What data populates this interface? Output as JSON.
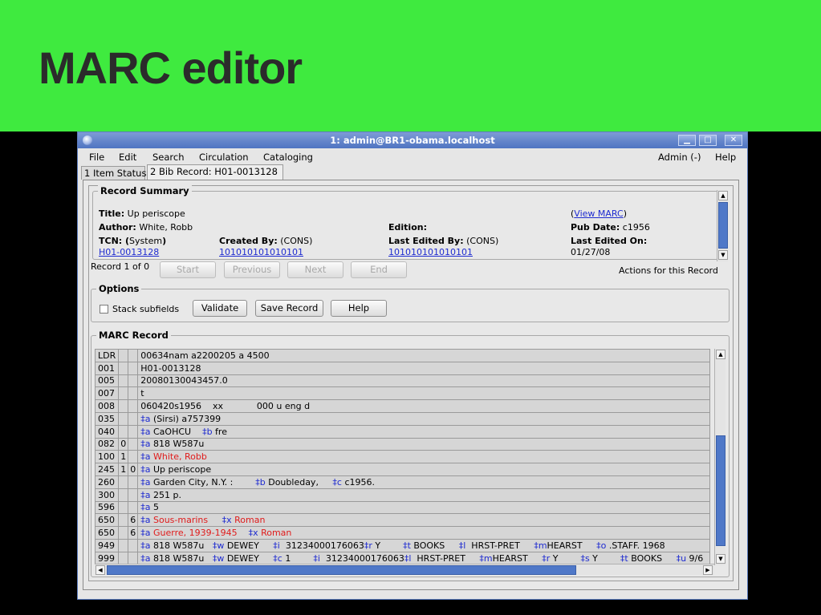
{
  "banner": {
    "title": "MARC editor"
  },
  "window": {
    "title": "1: admin@BR1-obama.localhost",
    "minimize": "▁",
    "maximize": "□",
    "close": "✕"
  },
  "menu": {
    "file": "File",
    "edit": "Edit",
    "search": "Search",
    "circulation": "Circulation",
    "cataloging": "Cataloging",
    "admin": "Admin (-)",
    "help": "Help"
  },
  "tabs": [
    {
      "label": "1 Item Status"
    },
    {
      "label": "2 Bib Record: H01-0013128"
    }
  ],
  "summary": {
    "legend": "Record Summary",
    "title_label": "Title:",
    "title_value": "Up periscope",
    "author_label": "Author:",
    "author_value": "White, Robb",
    "edition_label": "Edition:",
    "tcn_label": "TCN: (",
    "tcn_source": "System",
    "tcn_close": ")",
    "tcn_value": "H01-0013128",
    "created_label": "Created By:",
    "created_value": "(CONS)",
    "created_link": "101010101010101",
    "edited_label": "Last Edited By:",
    "edited_value": "(CONS)",
    "edited_link": "101010101010101",
    "view_marc_open": "(",
    "view_marc": "View MARC",
    "view_marc_close": ")",
    "pubdate_label": "Pub Date:",
    "pubdate_value": "c1956",
    "edited_on_label": "Last Edited On:",
    "edited_on_value": "01/27/08"
  },
  "nav": {
    "record_count": "Record 1 of 0",
    "start": "Start",
    "previous": "Previous",
    "next": "Next",
    "end": "End",
    "actions": "Actions for this Record"
  },
  "options": {
    "legend": "Options",
    "stack_label": "Stack subfields",
    "validate": "Validate",
    "save": "Save Record",
    "help": "Help"
  },
  "marc": {
    "legend": "MARC Record",
    "rows": [
      {
        "tag": "LDR",
        "i1": "",
        "i2": "",
        "segs": [
          {
            "t": "00634nam a2200205 a 4500"
          }
        ]
      },
      {
        "tag": "001",
        "i1": "",
        "i2": "",
        "segs": [
          {
            "t": "H01-0013128"
          }
        ]
      },
      {
        "tag": "005",
        "i1": "",
        "i2": "",
        "segs": [
          {
            "t": "20080130043457.0"
          }
        ]
      },
      {
        "tag": "007",
        "i1": "",
        "i2": "",
        "segs": [
          {
            "t": "t"
          }
        ]
      },
      {
        "tag": "008",
        "i1": "",
        "i2": "",
        "segs": [
          {
            "t": "060420s1956    xx            000 u eng d"
          }
        ]
      },
      {
        "tag": "035",
        "i1": "",
        "i2": "",
        "segs": [
          {
            "c": "sf",
            "t": "‡a"
          },
          {
            "t": " (Sirsi) a757399"
          }
        ]
      },
      {
        "tag": "040",
        "i1": "",
        "i2": "",
        "segs": [
          {
            "c": "sf",
            "t": "‡a"
          },
          {
            "t": " CaOHCU    "
          },
          {
            "c": "sf",
            "t": "‡b"
          },
          {
            "t": " fre"
          }
        ]
      },
      {
        "tag": "082",
        "i1": "0",
        "i2": "",
        "segs": [
          {
            "c": "sf",
            "t": "‡a"
          },
          {
            "t": " 818 W587u"
          }
        ]
      },
      {
        "tag": "100",
        "i1": "1",
        "i2": "",
        "segs": [
          {
            "c": "sf",
            "t": "‡a"
          },
          {
            "c": "red",
            "t": " White, Robb"
          }
        ]
      },
      {
        "tag": "245",
        "i1": "1",
        "i2": "0",
        "segs": [
          {
            "c": "sf",
            "t": "‡a"
          },
          {
            "t": " Up periscope"
          }
        ]
      },
      {
        "tag": "260",
        "i1": "",
        "i2": "",
        "segs": [
          {
            "c": "sf",
            "t": "‡a"
          },
          {
            "t": " Garden City, N.Y. :        "
          },
          {
            "c": "sf",
            "t": "‡b"
          },
          {
            "t": " Doubleday,     "
          },
          {
            "c": "sf",
            "t": "‡c"
          },
          {
            "t": " c1956."
          }
        ]
      },
      {
        "tag": "300",
        "i1": "",
        "i2": "",
        "segs": [
          {
            "c": "sf",
            "t": "‡a"
          },
          {
            "t": " 251 p."
          }
        ]
      },
      {
        "tag": "596",
        "i1": "",
        "i2": "",
        "segs": [
          {
            "c": "sf",
            "t": "‡a"
          },
          {
            "t": " 5"
          }
        ]
      },
      {
        "tag": "650",
        "i1": "",
        "i2": "6",
        "segs": [
          {
            "c": "sf",
            "t": "‡a"
          },
          {
            "c": "red",
            "t": " Sous-marins     "
          },
          {
            "c": "sf",
            "t": "‡x"
          },
          {
            "c": "red",
            "t": " Roman"
          }
        ]
      },
      {
        "tag": "650",
        "i1": "",
        "i2": "6",
        "segs": [
          {
            "c": "sf",
            "t": "‡a"
          },
          {
            "c": "red",
            "t": " Guerre, 1939-1945    "
          },
          {
            "c": "sf",
            "t": "‡x"
          },
          {
            "c": "red",
            "t": " Roman"
          }
        ]
      },
      {
        "tag": "949",
        "i1": "",
        "i2": "",
        "segs": [
          {
            "c": "sf",
            "t": "‡a"
          },
          {
            "t": " 818 W587u   "
          },
          {
            "c": "sf",
            "t": "‡w"
          },
          {
            "t": " DEWEY     "
          },
          {
            "c": "sf",
            "t": "‡i"
          },
          {
            "t": "  31234000176063"
          },
          {
            "c": "sf",
            "t": "‡r"
          },
          {
            "t": " Y        "
          },
          {
            "c": "sf",
            "t": "‡t"
          },
          {
            "t": " BOOKS     "
          },
          {
            "c": "sf",
            "t": "‡l"
          },
          {
            "t": "  HRST-PRET     "
          },
          {
            "c": "sf",
            "t": "‡m"
          },
          {
            "t": "HEARST     "
          },
          {
            "c": "sf",
            "t": "‡o"
          },
          {
            "t": " .STAFF. 1968"
          }
        ]
      },
      {
        "tag": "999",
        "i1": "",
        "i2": "",
        "segs": [
          {
            "c": "sf",
            "t": "‡a"
          },
          {
            "t": " 818 W587u   "
          },
          {
            "c": "sf",
            "t": "‡w"
          },
          {
            "t": " DEWEY     "
          },
          {
            "c": "sf",
            "t": "‡c"
          },
          {
            "t": " 1        "
          },
          {
            "c": "sf",
            "t": "‡i"
          },
          {
            "t": "  31234000176063"
          },
          {
            "c": "sf",
            "t": "‡l"
          },
          {
            "t": "  HRST-PRET     "
          },
          {
            "c": "sf",
            "t": "‡m"
          },
          {
            "t": "HEARST     "
          },
          {
            "c": "sf",
            "t": "‡r"
          },
          {
            "t": " Y        "
          },
          {
            "c": "sf",
            "t": "‡s"
          },
          {
            "t": " Y        "
          },
          {
            "c": "sf",
            "t": "‡t"
          },
          {
            "t": " BOOKS     "
          },
          {
            "c": "sf",
            "t": "‡u"
          },
          {
            "t": " 9/6"
          }
        ]
      }
    ]
  },
  "icons": {
    "scroll_up": "▲",
    "scroll_down": "▼",
    "scroll_left": "◀",
    "scroll_right": "▶",
    "grip": ":::"
  }
}
